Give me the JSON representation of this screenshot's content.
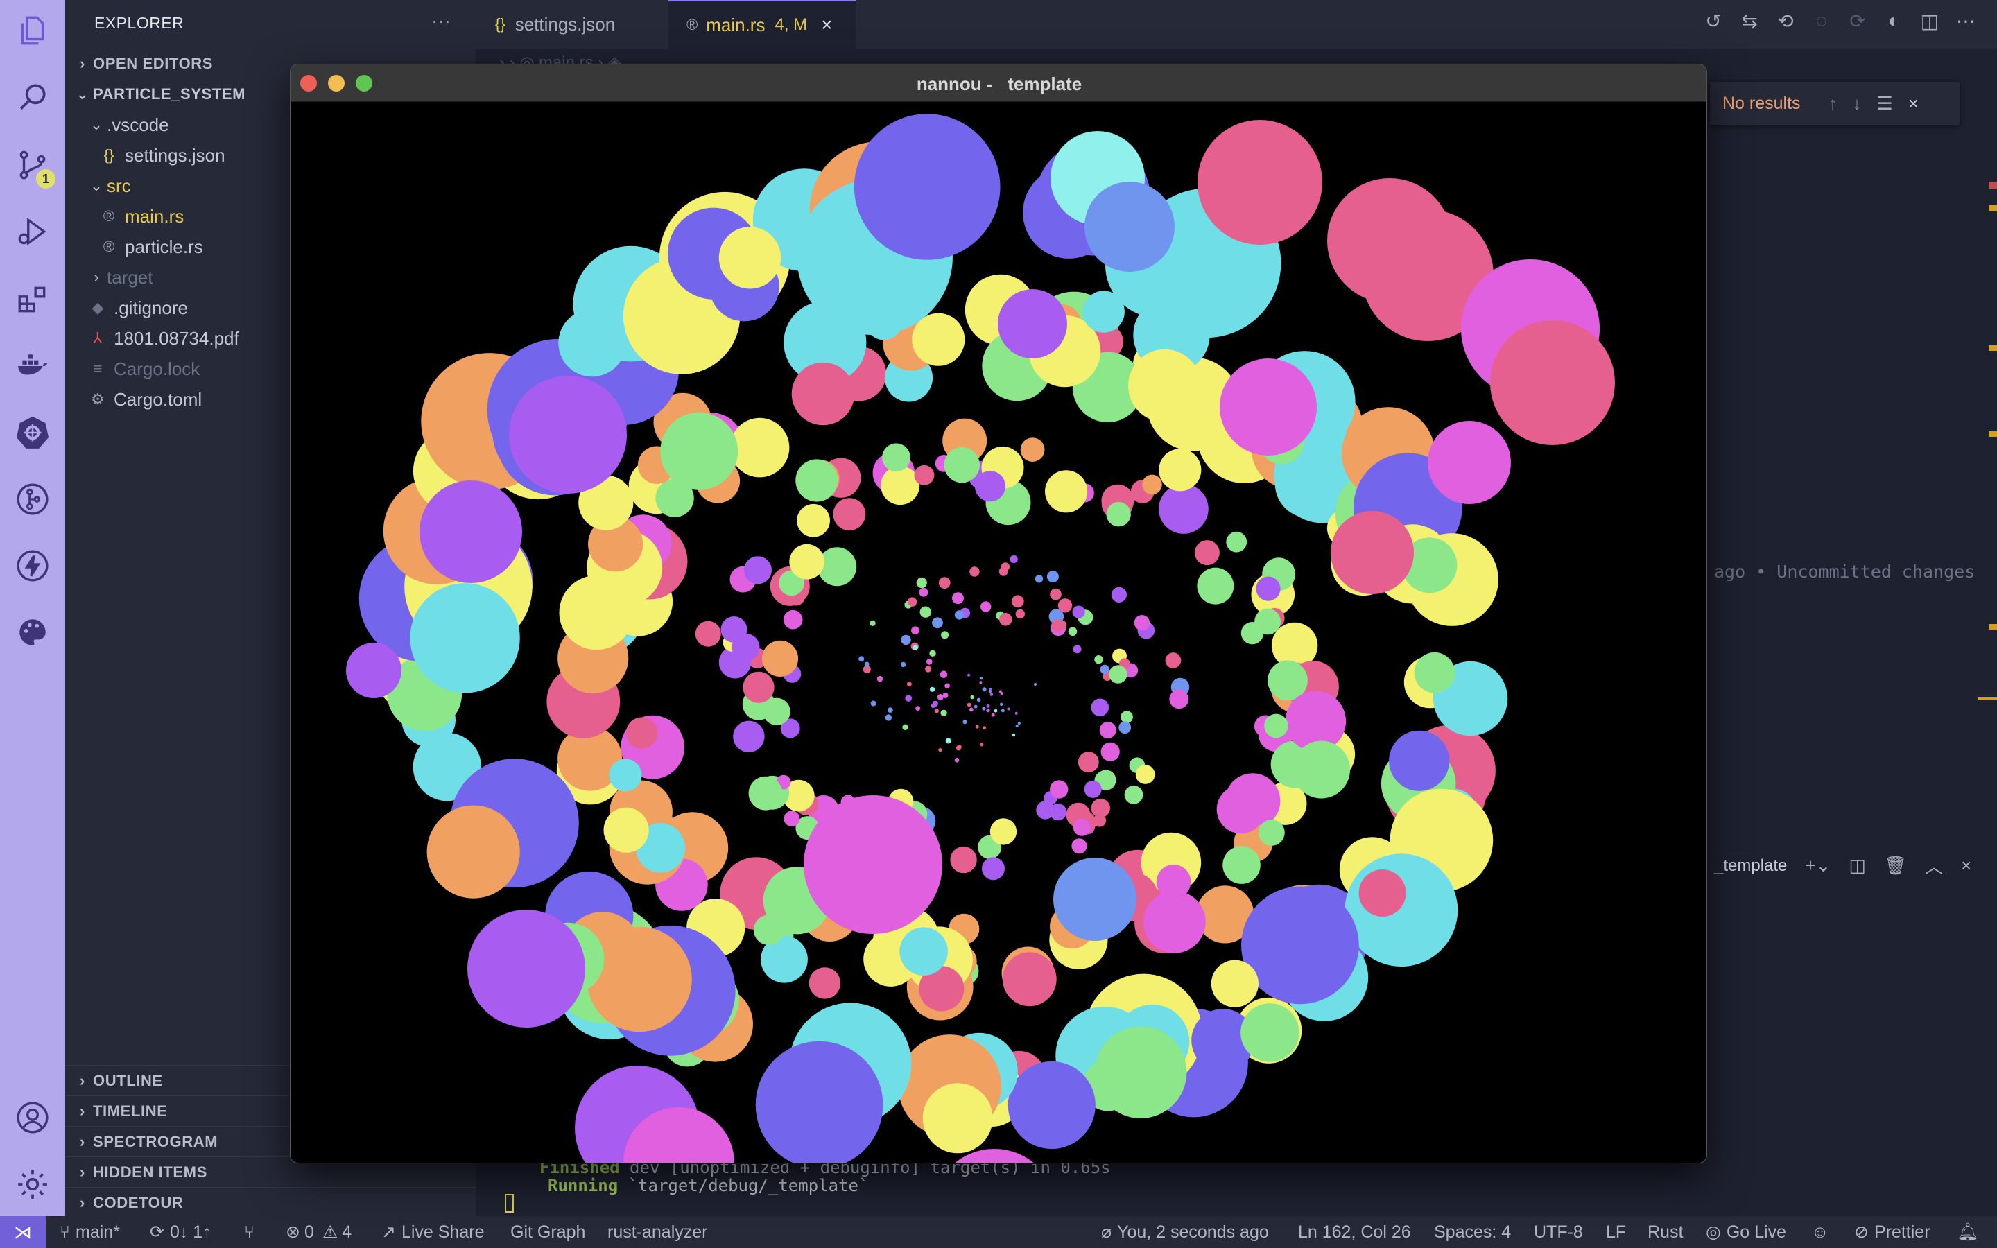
{
  "activity_bar": {
    "scm_badge": "1",
    "items": [
      "files-icon",
      "search-icon",
      "source-control-icon",
      "run-debug-icon",
      "extensions-icon",
      "docker-icon",
      "kubernetes-icon",
      "git-graph-icon",
      "thunder-client-icon",
      "theme-palette-icon"
    ],
    "bottom": [
      "account-icon",
      "settings-gear-icon"
    ]
  },
  "sidebar": {
    "title": "EXPLORER",
    "more": "···",
    "open_editors": "OPEN EDITORS",
    "project": "PARTICLE_SYSTEM",
    "tree": {
      "vscode_folder": ".vscode",
      "settings_json": "settings.json",
      "src_folder": "src",
      "main_rs": "main.rs",
      "particle_rs": "particle.rs",
      "target_folder": "target",
      "gitignore": ".gitignore",
      "pdf": "1801.08734.pdf",
      "cargo_lock": "Cargo.lock",
      "cargo_toml": "Cargo.toml"
    },
    "sections": {
      "outline": "OUTLINE",
      "timeline": "TIMELINE",
      "spectrogram": "SPECTROGRAM",
      "hidden_items": "HIDDEN ITEMS",
      "codetour": "CODETOUR"
    }
  },
  "tabs": {
    "settings_label": "settings.json",
    "main_label": "main.rs",
    "main_status": "4, M"
  },
  "editor": {
    "blame": "ago • Uncommitted changes"
  },
  "find_widget": {
    "result": "No results"
  },
  "panel": {
    "terminal_name": "_template",
    "lines": {
      "finished_word": "Finished",
      "finished_rest": " dev [unoptimized + debuginfo] target(s) in 0.65s",
      "running_word": "Running",
      "running_rest": " `target/debug/_template`"
    }
  },
  "status_bar": {
    "branch": "main*",
    "sync": "0↓ 1↑",
    "errors": "0",
    "warnings": "4",
    "live_share": "Live Share",
    "git_graph": "Git Graph",
    "rust_analyzer": "rust-analyzer",
    "blame": "You, 2 seconds ago",
    "cursor": "Ln 162, Col 26",
    "spaces": "Spaces: 4",
    "encoding": "UTF-8",
    "eol": "LF",
    "language": "Rust",
    "go_live": "Go Live",
    "prettier": "Prettier"
  },
  "nannou_window": {
    "title": "nannou - _template",
    "colors": {
      "close": "#ed5f57",
      "minimize": "#f5bd4f",
      "maximize": "#5fc653"
    },
    "particle_colors": [
      "#8ff0ec",
      "#6f95ef",
      "#a85cf0",
      "#e060e0",
      "#e5608e",
      "#8ce68a",
      "#f4f070",
      "#f0a060",
      "#70dee6",
      "#7466ec"
    ]
  }
}
